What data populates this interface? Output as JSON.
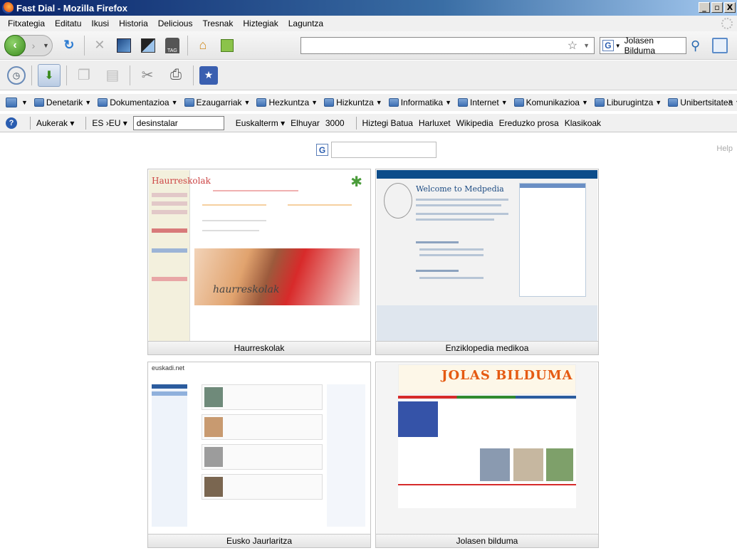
{
  "window": {
    "title": "Fast Dial - Mozilla Firefox",
    "buttons": {
      "minimize": "_",
      "maximize": "▫",
      "close": "X"
    }
  },
  "menu": [
    "Fitxategia",
    "Editatu",
    "Ikusi",
    "Historia",
    "Delicious",
    "Tresnak",
    "Hiztegiak",
    "Laguntza"
  ],
  "navbar": {
    "url": "",
    "search_value": "Jolasen Bilduma"
  },
  "bookmarks": [
    "Denetarik",
    "Dokumentazioa",
    "Ezaugarriak",
    "Hezkuntza",
    "Hizkuntza",
    "Informatika",
    "Internet",
    "Komunikazioa",
    "Liburugintza",
    "Unibertsitatea"
  ],
  "translator": {
    "aukerak": "Aukerak",
    "lang": "ES ›EU",
    "input_value": "desinstalar",
    "links": [
      "Euskalterm",
      "Elhuyar",
      "3000",
      "Hiztegi Batua",
      "Harluxet",
      "Wikipedia",
      "Ereduzko prosa",
      "Klasikoak"
    ]
  },
  "content": {
    "help": "Help",
    "dials": [
      {
        "label": "Haurreskolak"
      },
      {
        "label": "Enziklopedia medikoa"
      },
      {
        "label": "Eusko Jaurlaritza"
      },
      {
        "label": "Jolasen bilduma"
      }
    ]
  },
  "thumbnails": {
    "haurreskolak_logo": "Haurreskolak",
    "haurreskolak_photo_text": "haurreskolak",
    "medpedia_heading": "Welcome to Medpedia",
    "euskadi_brand": "euskadi.net",
    "jolas_title": "JOLAS BILDUMA"
  }
}
